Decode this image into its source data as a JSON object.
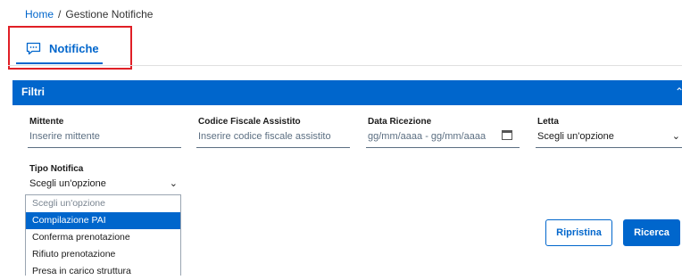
{
  "breadcrumb": {
    "home": "Home",
    "separator": "/",
    "current": "Gestione Notifiche"
  },
  "tab": {
    "label": "Notifiche",
    "icon": "chat-bubble-icon"
  },
  "filters": {
    "title": "Filtri",
    "collapse_icon": "chevron-up-icon",
    "mittente": {
      "label": "Mittente",
      "placeholder": "Inserire mittente"
    },
    "codice_fiscale": {
      "label": "Codice Fiscale Assistito",
      "placeholder": "Inserire codice fiscale assistito"
    },
    "data_ricezione": {
      "label": "Data Ricezione",
      "placeholder": "gg/mm/aaaa - gg/mm/aaaa",
      "icon": "calendar-icon"
    },
    "letta": {
      "label": "Letta",
      "value": "Scegli un'opzione"
    },
    "tipo_notifica": {
      "label": "Tipo Notifica",
      "value": "Scegli un'opzione",
      "options": [
        "Scegli un'opzione",
        "Compilazione PAI",
        "Conferma prenotazione",
        "Rifiuto prenotazione",
        "Presa in carico struttura"
      ],
      "highlighted_option": "Compilazione PAI"
    }
  },
  "buttons": {
    "reset": "Ripristina",
    "search": "Ricerca"
  },
  "colors": {
    "primary": "#0066cc",
    "highlight_border": "#e01f26"
  }
}
